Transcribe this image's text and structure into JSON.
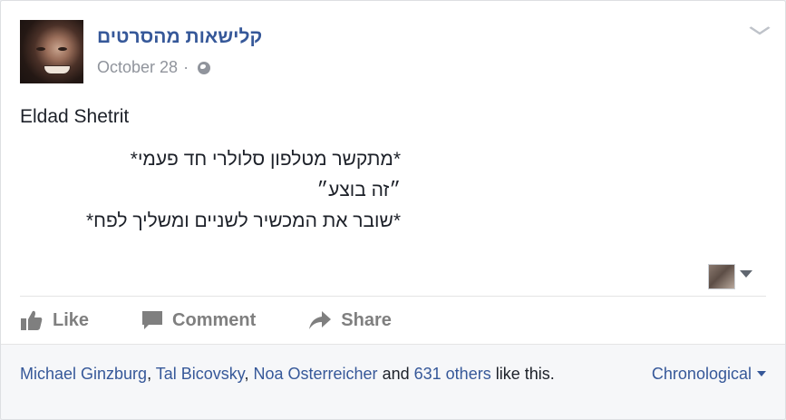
{
  "post": {
    "page_name": "קלישאות מהסרטים",
    "date": "October 28",
    "separator": "·",
    "privacy_icon": "globe-icon",
    "author": "Eldad Shetrit",
    "lines": [
      "*מתקשר מטלפון סלולרי חד פעמי*",
      "״זה בוצע״",
      "*שובר את המכשיר לשניים ומשליך לפח*"
    ]
  },
  "actions": {
    "like": "Like",
    "comment": "Comment",
    "share": "Share"
  },
  "footer": {
    "likers": [
      "Michael Ginzburg",
      "Tal Bicovsky",
      "Noa Osterreicher"
    ],
    "comma": ",",
    "and": "and",
    "others": "631 others",
    "suffix": "like this.",
    "sort_label": "Chronological"
  },
  "colors": {
    "link": "#365899",
    "text": "#1d2129",
    "muted": "#90949c",
    "action": "#7f7f7f",
    "footer_bg": "#f6f7f9"
  }
}
